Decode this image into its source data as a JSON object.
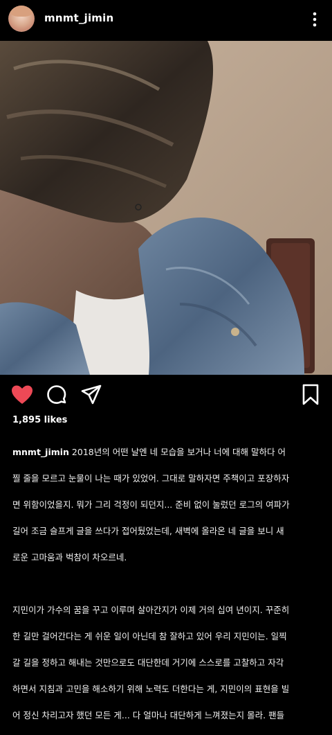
{
  "header": {
    "username": "mnmt_jimin",
    "avatar_icon": "profile-avatar",
    "more_icon": "more-vertical-icon"
  },
  "actions": {
    "like_icon": "heart-filled-icon",
    "like_color": "#ed4956",
    "comment_icon": "comment-icon",
    "share_icon": "send-icon",
    "save_icon": "bookmark-icon"
  },
  "post": {
    "likes": "1,895 likes",
    "caption_username": "mnmt_jimin",
    "caption_lines": [
      " 2018년의 어떤 날엔 네 모습을 보거나 너에 대해 말하다 어",
      "찔 줄을 모르고 눈물이 나는 때가 있었어. 그대로 말하자면 주책이고 포장하자",
      "면 위함이었을지. 뭐가 그리 걱정이 되던지... 준비 없이 눌렀던 로그의 여파가",
      "길어 조금 슬프게 글을 쓰다가 접어뒀었는데, 새벽에 올라온 네 글을 보니 새",
      "로운 고마움과 벅참이 차오르네."
    ],
    "caption_lines_2": [
      "지민이가 가수의 꿈을 꾸고 이루며 살아간지가 이제 거의 십여 년이지. 꾸준히",
      "한 길만 걸어간다는 게 쉬운 일이 아닌데 참 잘하고 있어 우리 지민이는. 일찍",
      "갈 길을 정하고 해내는 것만으로도 대단한데 거기에 스스로를 고찰하고 자각",
      "하면서 지침과 고민을 해소하기 위해 노력도 더한다는 게, 지민이의 표현을 빌",
      "어 정신 차리고자 했던 모든 게... 다 얼마나 대단하게 느껴졌는지 몰라. 팬들"
    ]
  }
}
